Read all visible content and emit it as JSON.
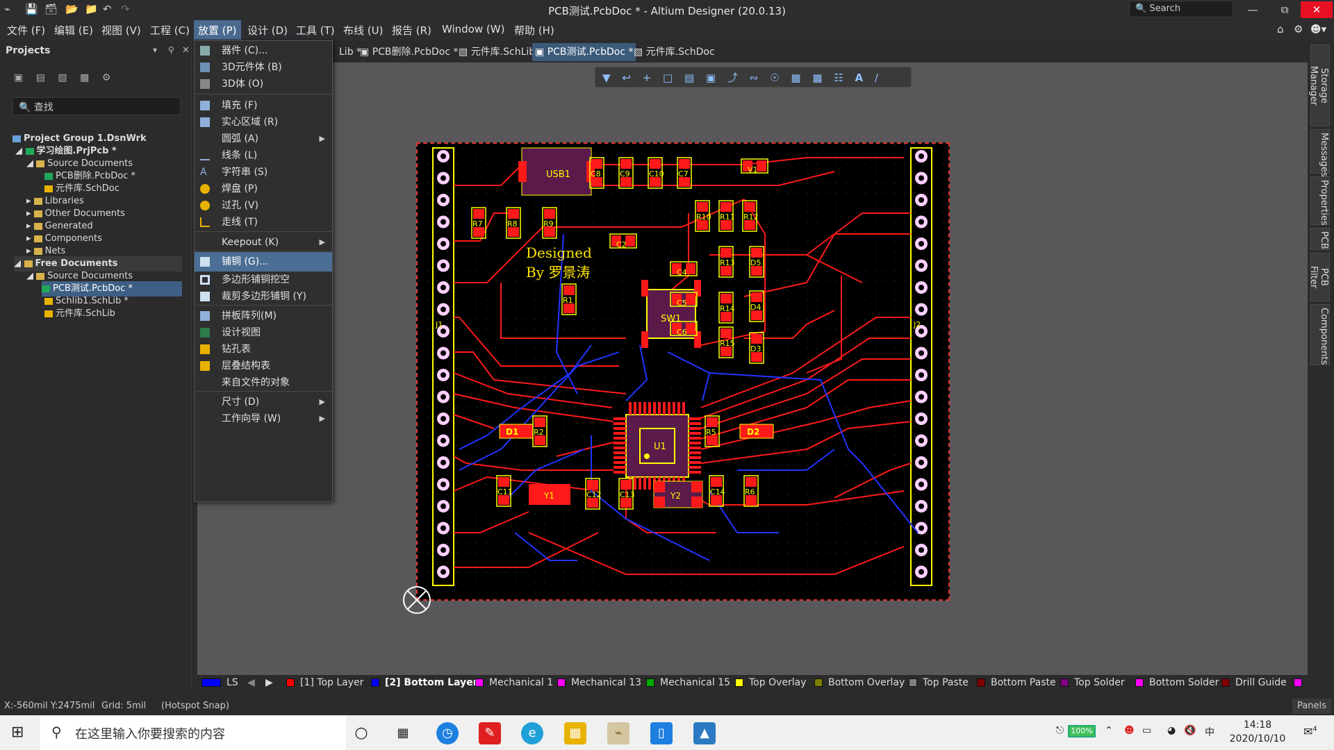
{
  "window": {
    "title": "PCB测试.PcbDoc * - Altium Designer (20.0.13)",
    "search": "Search"
  },
  "menubar": [
    "文件 (F)",
    "编辑 (E)",
    "视图 (V)",
    "工程 (C)",
    "放置 (P)",
    "设计 (D)",
    "工具 (T)",
    "布线 (U)",
    "报告 (R)",
    "Window (W)",
    "帮助 (H)"
  ],
  "projects": {
    "title": "Projects",
    "search_placeholder": "查找",
    "tree": [
      {
        "label": "Project Group 1.DsnWrk",
        "icon": "workspace-icon"
      },
      {
        "label": "学习绘图.PrjPcb *",
        "icon": "project-icon"
      },
      {
        "label": "Source Documents",
        "icon": "folder-icon"
      },
      {
        "label": "PCB删除.PcbDoc *",
        "icon": "pcb-doc-icon"
      },
      {
        "label": "元件库.SchDoc",
        "icon": "sch-doc-icon"
      },
      {
        "label": "Libraries",
        "icon": "folder-icon"
      },
      {
        "label": "Other Documents",
        "icon": "folder-icon"
      },
      {
        "label": "Generated",
        "icon": "folder-icon"
      },
      {
        "label": "Components",
        "icon": "folder-icon"
      },
      {
        "label": "Nets",
        "icon": "folder-icon"
      },
      {
        "label": "Free Documents",
        "icon": "free-docs-icon"
      },
      {
        "label": "Source Documents",
        "icon": "folder-icon"
      },
      {
        "label": "PCB测试.PcbDoc *",
        "icon": "pcb-doc-icon"
      },
      {
        "label": "Schlib1.SchLib *",
        "icon": "schlib-icon"
      },
      {
        "label": "元件库.SchLib",
        "icon": "schlib-icon"
      }
    ]
  },
  "tabs": [
    "Lib *",
    "PCB删除.PcbDoc *",
    "元件库.SchLib",
    "PCB测试.PcbDoc *",
    "元件库.SchDoc"
  ],
  "place_menu": [
    {
      "label": "器件 (C)...",
      "icon": "component-icon"
    },
    {
      "label": "3D元件体 (B)",
      "icon": "3d-body-icon"
    },
    {
      "label": "3D体 (O)",
      "icon": "3d-icon"
    },
    {
      "label": "填充 (F)",
      "icon": "fill-icon"
    },
    {
      "label": "实心区域 (R)",
      "icon": "solid-region-icon"
    },
    {
      "label": "圆弧 (A)",
      "icon": ""
    },
    {
      "label": "线条 (L)",
      "icon": "line-icon"
    },
    {
      "label": "字符串 (S)",
      "icon": "string-icon"
    },
    {
      "label": "焊盘 (P)",
      "icon": "pad-icon"
    },
    {
      "label": "过孔 (V)",
      "icon": "via-icon"
    },
    {
      "label": "走线 (T)",
      "icon": "track-icon"
    },
    {
      "label": "Keepout (K)",
      "icon": ""
    },
    {
      "label": "铺铜 (G)...",
      "icon": "polygon-pour-icon"
    },
    {
      "label": "多边形铺铜挖空",
      "icon": "polygon-cutout-icon"
    },
    {
      "label": "裁剪多边形铺铜 (Y)",
      "icon": "slice-polygon-icon"
    },
    {
      "label": "拼板阵列(M)",
      "icon": "panel-array-icon"
    },
    {
      "label": "设计视图",
      "icon": "design-view-icon"
    },
    {
      "label": "钻孔表",
      "icon": "drill-table-icon"
    },
    {
      "label": "层叠结构表",
      "icon": "layer-stack-icon"
    },
    {
      "label": "来自文件的对象",
      "icon": ""
    },
    {
      "label": "尺寸 (D)",
      "icon": ""
    },
    {
      "label": "工作向导 (W)",
      "icon": ""
    }
  ],
  "board": {
    "text1": "Designed",
    "text2": "By 罗景涛",
    "designators": [
      "USB1",
      "C8",
      "C9",
      "C10",
      "C7",
      "V1",
      "R7",
      "R8",
      "R9",
      "R10",
      "R11",
      "R12",
      "C2",
      "R13",
      "D5",
      "C4",
      "SW1",
      "R1",
      "C5",
      "R14",
      "D4",
      "C6",
      "R15",
      "D3",
      "J1",
      "J2",
      "U1",
      "D1",
      "R2",
      "R5",
      "D2",
      "C11",
      "Y1",
      "C12",
      "C13",
      "Y2",
      "C14",
      "R6"
    ]
  },
  "right_panels": [
    "Storage Manager",
    "Messages",
    "Properties",
    "PCB",
    "PCB Filter",
    "Components"
  ],
  "layers": [
    {
      "label": "LS",
      "color": "#0000ff"
    },
    {
      "label": "[1] Top Layer",
      "color": "#ff0000"
    },
    {
      "label": "[2] Bottom Layer",
      "color": "#0000ff"
    },
    {
      "label": "Mechanical 1",
      "color": "#ff00ff"
    },
    {
      "label": "Mechanical 13",
      "color": "#ff00ff"
    },
    {
      "label": "Mechanical 15",
      "color": "#00aa00"
    },
    {
      "label": "Top Overlay",
      "color": "#ffff00"
    },
    {
      "label": "Bottom Overlay",
      "color": "#808000"
    },
    {
      "label": "Top Paste",
      "color": "#808080"
    },
    {
      "label": "Bottom Paste",
      "color": "#800000"
    },
    {
      "label": "Top Solder",
      "color": "#800080"
    },
    {
      "label": "Bottom Solder",
      "color": "#ff00ff"
    },
    {
      "label": "Drill Guide",
      "color": "#800000"
    }
  ],
  "status": {
    "coords": "X:-560mil Y:2475mil",
    "grid": "Grid: 5mil",
    "snap": "(Hotspot Snap)",
    "panels": "Panels"
  },
  "taskbar": {
    "search": "在这里输入你要搜索的内容",
    "battery": "100%",
    "ime": "中",
    "time": "14:18",
    "date": "2020/10/10",
    "notifications": "4"
  }
}
